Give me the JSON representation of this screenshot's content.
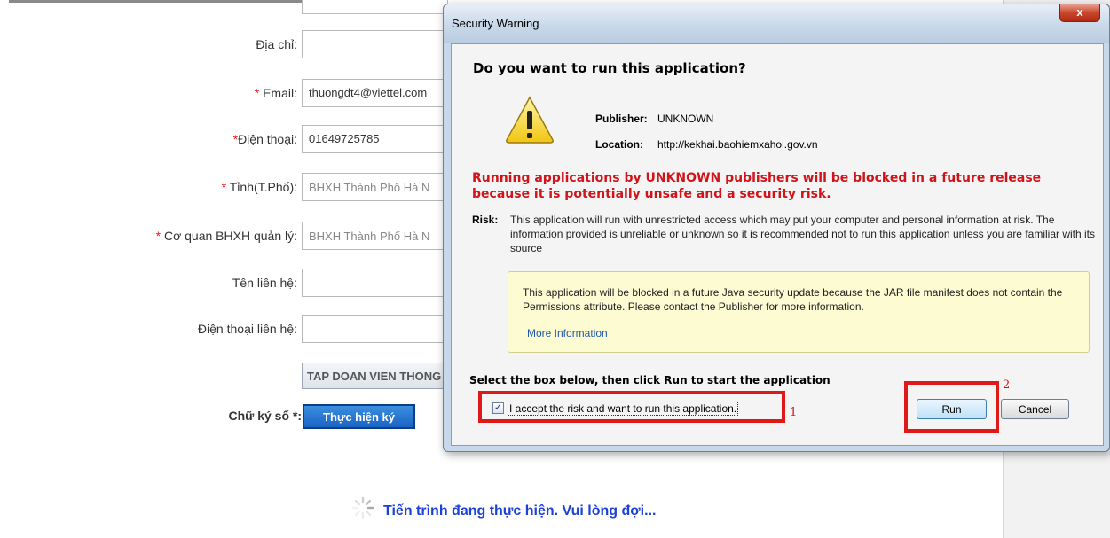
{
  "form": {
    "fields": [
      {
        "required_mark": "",
        "label": "Địa chỉ:",
        "value": ""
      },
      {
        "required_mark": "* ",
        "label": "Email:",
        "value": "thuongdt4@viettel.com"
      },
      {
        "required_mark": "*",
        "label": "Điện thoại:",
        "value": "01649725785"
      },
      {
        "required_mark": "* ",
        "label": "Tỉnh(T.Phố):",
        "value": "BHXH Thành Phố Hà N"
      },
      {
        "required_mark": "* ",
        "label": "Cơ quan BHXH quản lý:",
        "value": "BHXH Thành Phố Hà N"
      },
      {
        "required_mark": "",
        "label": "Tên liên hệ:",
        "value": ""
      },
      {
        "required_mark": "",
        "label": "Điện thoại liên hệ:",
        "value": ""
      }
    ],
    "org_name": "TAP DOAN VIEN THONG",
    "signature_label": "Chữ ký số *:",
    "sign_button": "Thực hiện ký",
    "progress_text": "Tiến trình đang thực hiện. Vui lòng đợi..."
  },
  "dialog": {
    "title": "Security Warning",
    "close_glyph": "x",
    "heading": "Do you want to run this application?",
    "publisher_label": "Publisher:",
    "publisher_value": "UNKNOWN",
    "location_label": "Location:",
    "location_value": "http://kekhai.baohiemxahoi.gov.vn",
    "danger_text": "Running applications by UNKNOWN publishers will be blocked in a future release because it is potentially unsafe and a security risk.",
    "risk_label": "Risk:",
    "risk_text": "This application will run with unrestricted access which may put your computer and personal information at risk. The information provided is unreliable or unknown so it is recommended not to run this application unless you are familiar with its source",
    "info_text": "This application will be blocked in a future Java security update because the JAR file manifest does not contain the Permissions attribute. Please contact the Publisher for more information.",
    "more_info_link": "More Information",
    "select_instruction": "Select the box below, then click Run to start the application",
    "checkbox_label": "I accept the risk and want to run this application.",
    "checkbox_checked": true,
    "checkbox_glyph": "✓",
    "run_button": "Run",
    "cancel_button": "Cancel"
  },
  "annotations": {
    "mark_1": "1",
    "mark_2": "2",
    "color": "#e01818"
  },
  "colors": {
    "required": "#e02020",
    "danger": "#d0141a",
    "progress": "#1b42d8",
    "sign_button": "#1a64c4",
    "info_background": "#fcfbd2"
  }
}
